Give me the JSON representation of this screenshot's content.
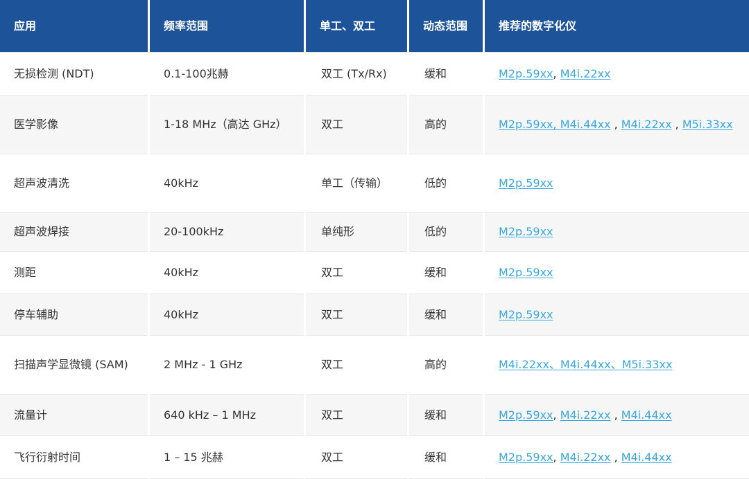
{
  "headers": [
    "应用",
    "频率范围",
    "单工、双工",
    "动态范围",
    "推荐的数字化仪"
  ],
  "rows": [
    {
      "app": "无损检测 (NDT)",
      "freq": "0.1-100兆赫",
      "mode": "双工 (Tx/Rx)",
      "dyn": "缓和",
      "links": [
        {
          "t": "M2p.59xx",
          "s": ", "
        },
        {
          "t": "M4i.22xx",
          "s": ""
        }
      ]
    },
    {
      "app": "医学影像",
      "freq": "1-18 MHz（高达 GHz）",
      "mode": "双工",
      "dyn": "高的",
      "links": [
        {
          "t": "M2p.59xx, M4i.44xx",
          "s": " , "
        },
        {
          "t": "M4i.22xx",
          "s": " , "
        },
        {
          "t": "M5i.33xx",
          "s": ""
        }
      ]
    },
    {
      "app": "超声波清洗",
      "freq": "40kHz",
      "mode": "单工（传输）",
      "dyn": "低的",
      "links": [
        {
          "t": "M2p.59xx",
          "s": ""
        }
      ]
    },
    {
      "app": "超声波焊接",
      "freq": "20-100kHz",
      "mode": "单纯形",
      "dyn": "低的",
      "links": [
        {
          "t": "M2p.59xx",
          "s": ""
        }
      ]
    },
    {
      "app": "测距",
      "freq": "40kHz",
      "mode": "双工",
      "dyn": "缓和",
      "links": [
        {
          "t": "M2p.59xx",
          "s": ""
        }
      ]
    },
    {
      "app": "停车辅助",
      "freq": "40kHz",
      "mode": "双工",
      "dyn": "缓和",
      "links": [
        {
          "t": "M2p.59xx",
          "s": ""
        }
      ]
    },
    {
      "app": "扫描声学显微镜 (SAM)",
      "freq": "2 MHz - 1 GHz",
      "mode": "双工",
      "dyn": "高的",
      "links": [
        {
          "t": "M4i.22xx、M4i.44xx、M5i.33xx",
          "s": ""
        }
      ]
    },
    {
      "app": "流量计",
      "freq": "640 kHz – 1 MHz",
      "mode": "双工",
      "dyn": "缓和",
      "links": [
        {
          "t": "M2p.59xx",
          "s": ", "
        },
        {
          "t": "M4i.22xx",
          "s": " , "
        },
        {
          "t": "M4i.44xx",
          "s": ""
        }
      ]
    },
    {
      "app": "飞行衍射时间",
      "freq": "1 – 15 兆赫",
      "mode": "双工",
      "dyn": "缓和",
      "links": [
        {
          "t": "M2p.59xx",
          "s": ", "
        },
        {
          "t": "M4i.22xx",
          "s": " , "
        },
        {
          "t": "M4i.44xx",
          "s": ""
        }
      ]
    }
  ]
}
